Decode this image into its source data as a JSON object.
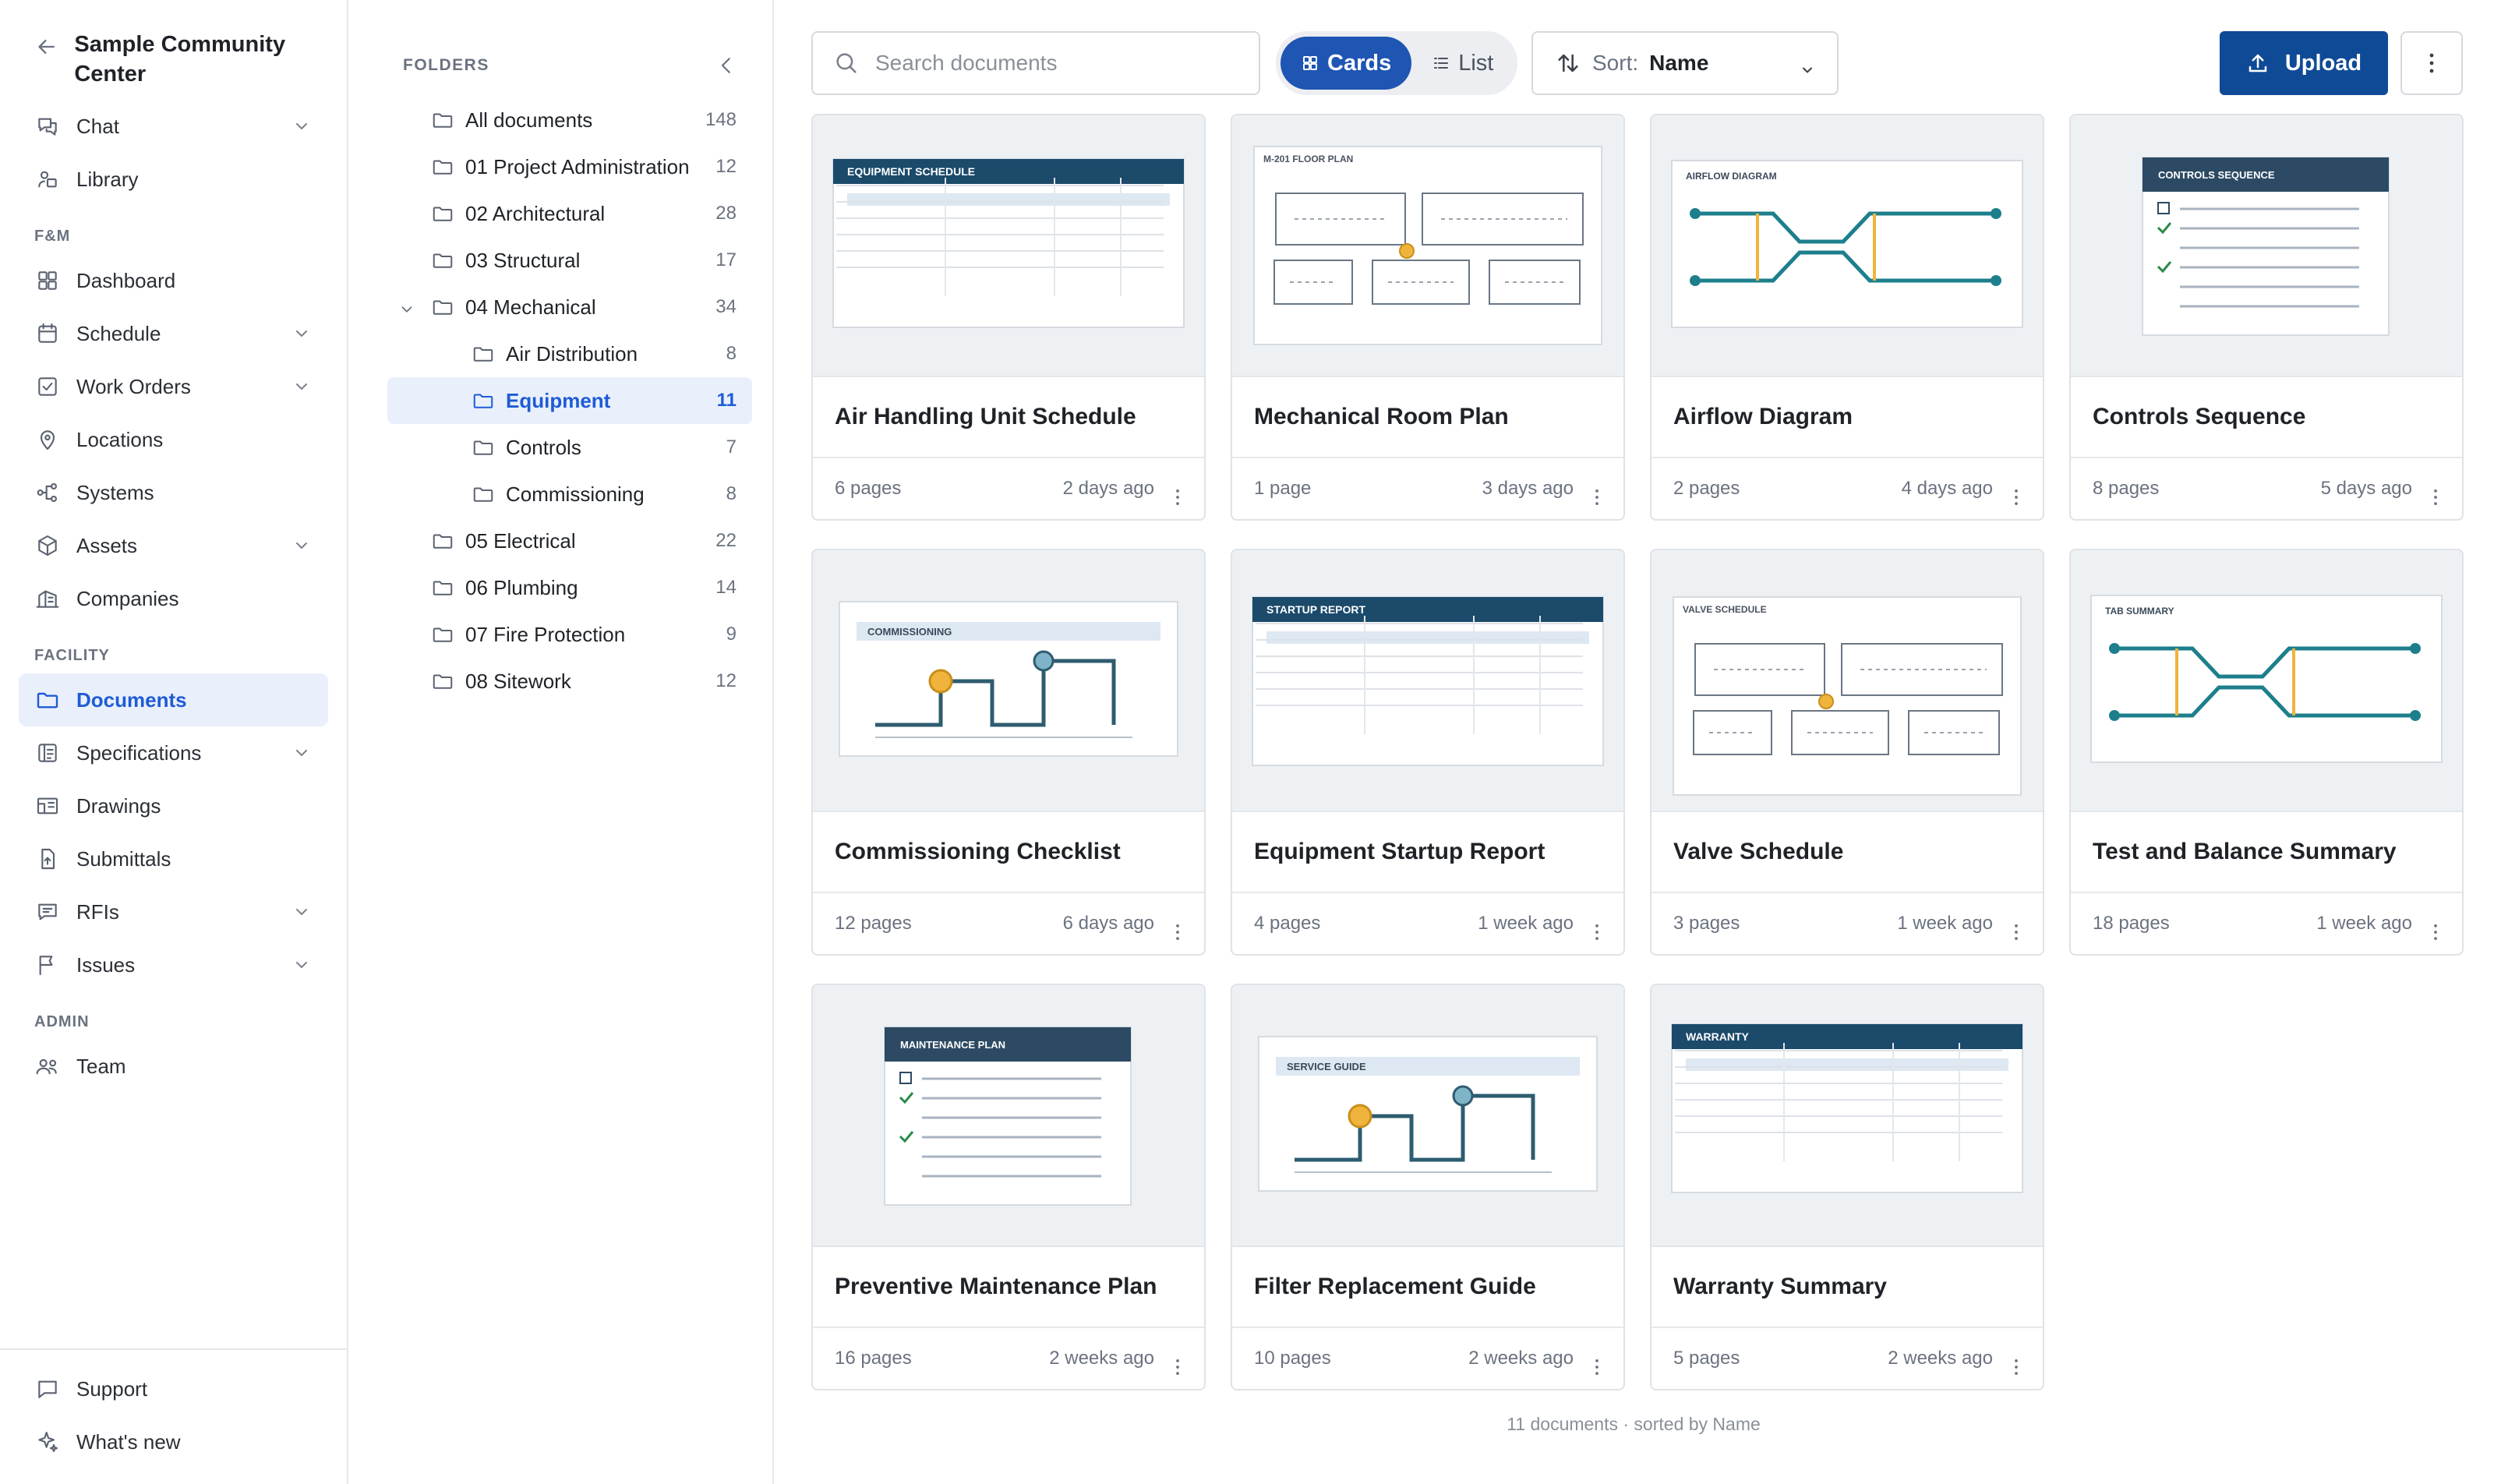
{
  "org": {
    "title": "Sample Community Center"
  },
  "nav": {
    "top": [
      {
        "key": "chat",
        "label": "Chat",
        "icon": "chat-icon",
        "expandable": true
      },
      {
        "key": "library",
        "label": "Library",
        "icon": "library-icon",
        "expandable": false
      }
    ],
    "sections": [
      {
        "label": "F&M",
        "items": [
          {
            "key": "dashboard",
            "label": "Dashboard",
            "icon": "dashboard-icon",
            "expandable": false
          },
          {
            "key": "schedule",
            "label": "Schedule",
            "icon": "calendar-icon",
            "expandable": true
          },
          {
            "key": "work-orders",
            "label": "Work Orders",
            "icon": "checkbox-icon",
            "expandable": true
          },
          {
            "key": "locations",
            "label": "Locations",
            "icon": "location-pin-icon",
            "expandable": false
          },
          {
            "key": "systems",
            "label": "Systems",
            "icon": "systems-icon",
            "expandable": false
          },
          {
            "key": "assets",
            "label": "Assets",
            "icon": "cube-icon",
            "expandable": true
          },
          {
            "key": "companies",
            "label": "Companies",
            "icon": "building-icon",
            "expandable": false
          }
        ]
      },
      {
        "label": "FACILITY",
        "items": [
          {
            "key": "documents",
            "label": "Documents",
            "icon": "folder-icon",
            "expandable": false,
            "active": true
          },
          {
            "key": "specifications",
            "label": "Specifications",
            "icon": "specs-icon",
            "expandable": true
          },
          {
            "key": "drawings",
            "label": "Drawings",
            "icon": "drawings-icon",
            "expandable": false
          },
          {
            "key": "submittals",
            "label": "Submittals",
            "icon": "submittal-icon",
            "expandable": false
          },
          {
            "key": "rfis",
            "label": "RFIs",
            "icon": "rfi-icon",
            "expandable": true
          },
          {
            "key": "issues",
            "label": "Issues",
            "icon": "flag-icon",
            "expandable": true
          }
        ]
      },
      {
        "label": "ADMIN",
        "items": [
          {
            "key": "team",
            "label": "Team",
            "icon": "team-icon",
            "expandable": false
          }
        ]
      }
    ],
    "bottom": [
      {
        "key": "support",
        "label": "Support",
        "icon": "message-icon"
      },
      {
        "key": "whats-new",
        "label": "What's new",
        "icon": "sparkle-icon"
      }
    ]
  },
  "folders": {
    "header": "FOLDERS",
    "items": [
      {
        "label": "All documents",
        "count": "148",
        "level": 0
      },
      {
        "label": "01 Project Administration",
        "count": "12",
        "level": 0
      },
      {
        "label": "02 Architectural",
        "count": "28",
        "level": 0
      },
      {
        "label": "03 Structural",
        "count": "17",
        "level": 0
      },
      {
        "label": "04 Mechanical",
        "count": "34",
        "level": 0,
        "expanded": true
      },
      {
        "label": "Air Distribution",
        "count": "8",
        "level": 1
      },
      {
        "label": "Equipment",
        "count": "11",
        "level": 1,
        "active": true
      },
      {
        "label": "Controls",
        "count": "7",
        "level": 1
      },
      {
        "label": "Commissioning",
        "count": "8",
        "level": 1
      },
      {
        "label": "05 Electrical",
        "count": "22",
        "level": 0
      },
      {
        "label": "06 Plumbing",
        "count": "14",
        "level": 0
      },
      {
        "label": "07 Fire Protection",
        "count": "9",
        "level": 0
      },
      {
        "label": "08 Sitework",
        "count": "12",
        "level": 0
      }
    ]
  },
  "toolbar": {
    "search_placeholder": "Search documents",
    "view_cards": "Cards",
    "view_list": "List",
    "sort_label": "Sort:",
    "sort_value": "Name",
    "upload_label": "Upload"
  },
  "colors": {
    "accent": "#1f55b3",
    "upload": "#0f4a97",
    "teal": "#1d7f8c",
    "amber": "#f0b43c",
    "navy": "#1b4a6b"
  },
  "documents": [
    {
      "name": "Air Handling Unit Schedule",
      "pages": "6 pages",
      "age": "2 days ago",
      "thumb": "table",
      "thumb_label": "EQUIPMENT SCHEDULE"
    },
    {
      "name": "Mechanical Room Plan",
      "pages": "1 page",
      "age": "3 days ago",
      "thumb": "plan",
      "thumb_label": "M-201 FLOOR PLAN"
    },
    {
      "name": "Airflow Diagram",
      "pages": "2 pages",
      "age": "4 days ago",
      "thumb": "flow",
      "thumb_label": "AIRFLOW DIAGRAM"
    },
    {
      "name": "Controls Sequence",
      "pages": "8 pages",
      "age": "5 days ago",
      "thumb": "checklist",
      "thumb_label": "CONTROLS SEQUENCE"
    },
    {
      "name": "Commissioning Checklist",
      "pages": "12 pages",
      "age": "6 days ago",
      "thumb": "steps",
      "thumb_label": "COMMISSIONING"
    },
    {
      "name": "Equipment Startup Report",
      "pages": "4 pages",
      "age": "1 week ago",
      "thumb": "table",
      "thumb_label": "STARTUP REPORT"
    },
    {
      "name": "Valve Schedule",
      "pages": "3 pages",
      "age": "1 week ago",
      "thumb": "plan",
      "thumb_label": "VALVE SCHEDULE"
    },
    {
      "name": "Test and Balance Summary",
      "pages": "18 pages",
      "age": "1 week ago",
      "thumb": "flow",
      "thumb_label": "TAB SUMMARY"
    },
    {
      "name": "Preventive Maintenance Plan",
      "pages": "16 pages",
      "age": "2 weeks ago",
      "thumb": "checklist",
      "thumb_label": "MAINTENANCE PLAN"
    },
    {
      "name": "Filter Replacement Guide",
      "pages": "10 pages",
      "age": "2 weeks ago",
      "thumb": "steps",
      "thumb_label": "SERVICE GUIDE"
    },
    {
      "name": "Warranty Summary",
      "pages": "5 pages",
      "age": "2 weeks ago",
      "thumb": "table",
      "thumb_label": "WARRANTY"
    }
  ],
  "summary": "11 documents · sorted by Name"
}
